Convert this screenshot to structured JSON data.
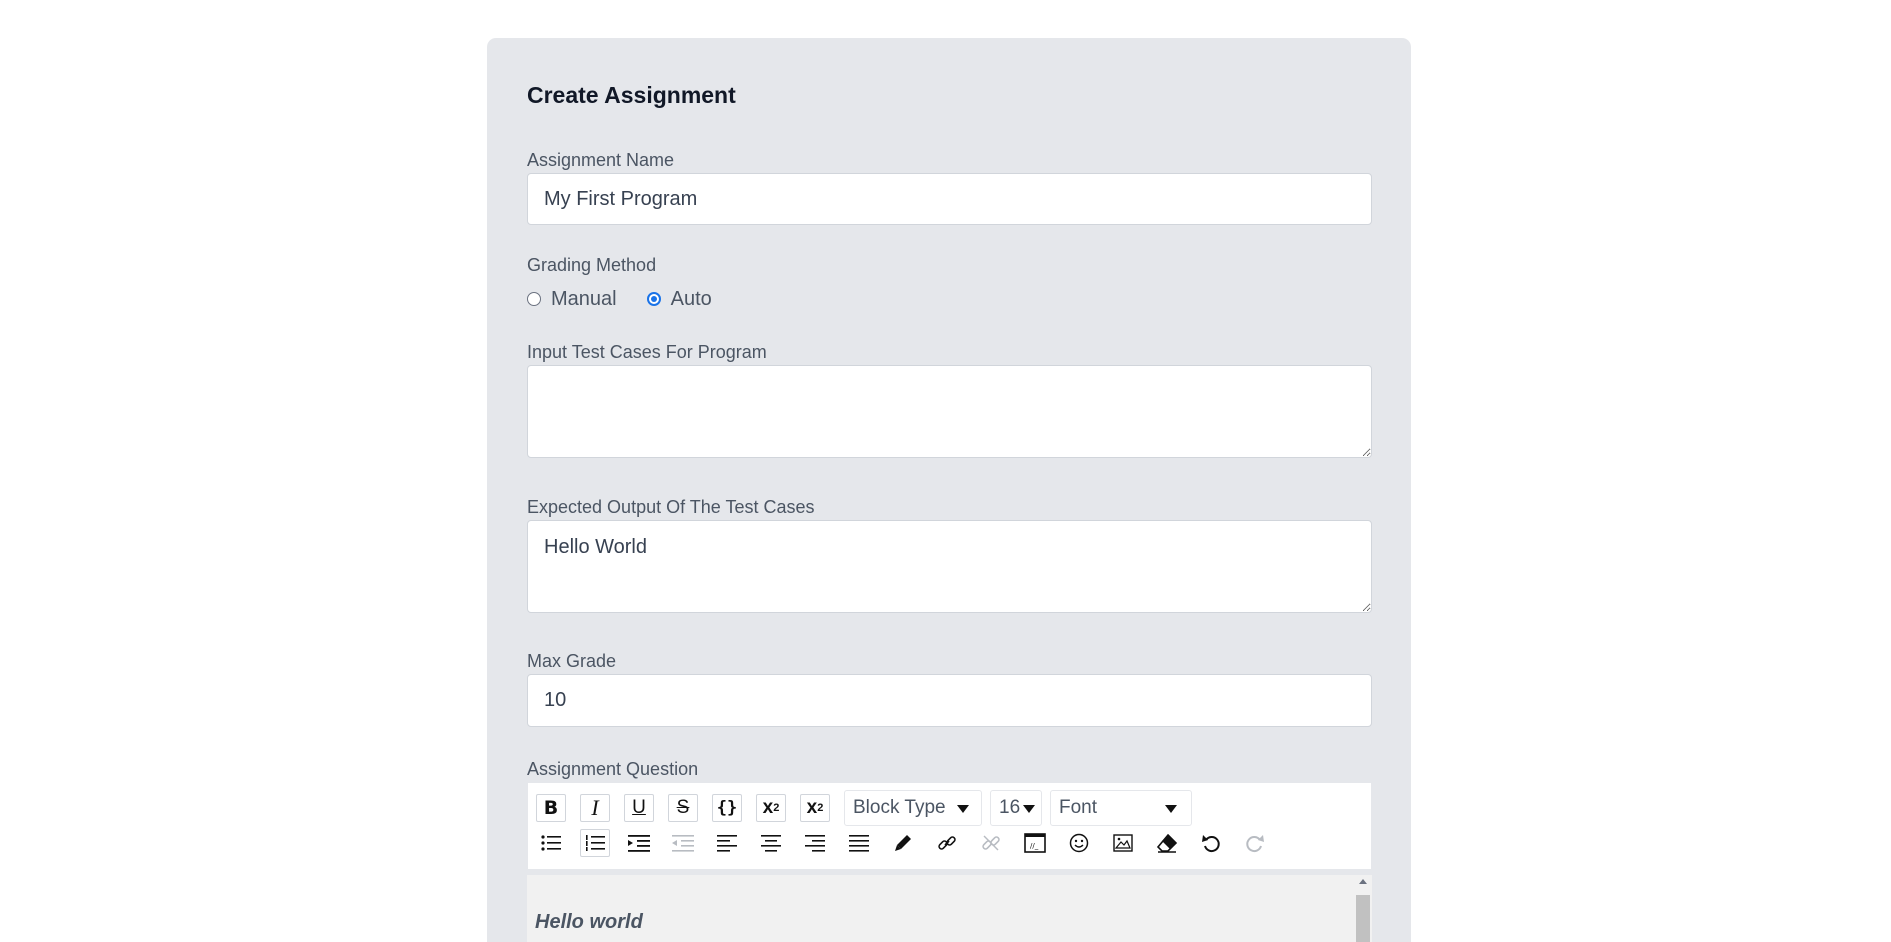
{
  "form": {
    "title": "Create Assignment",
    "assignment_name": {
      "label": "Assignment Name",
      "value": "My First Program"
    },
    "grading_method": {
      "label": "Grading Method",
      "options": [
        {
          "label": "Manual",
          "checked": false
        },
        {
          "label": "Auto",
          "checked": true
        }
      ]
    },
    "input_test_cases": {
      "label": "Input Test Cases For Program",
      "value": ""
    },
    "expected_output": {
      "label": "Expected Output Of The Test Cases",
      "value": "Hello World"
    },
    "max_grade": {
      "label": "Max Grade",
      "value": "10"
    },
    "assignment_question": {
      "label": "Assignment Question"
    }
  },
  "editor": {
    "block_type": "Block Type",
    "font_size": "16",
    "font": "Font",
    "content": "Hello world",
    "toolbar_row1_icons": [
      "bold-icon",
      "italic-icon",
      "underline-icon",
      "strikethrough-icon",
      "code-icon",
      "superscript-icon",
      "subscript-icon"
    ],
    "toolbar_row2_icons": [
      "unordered-list-icon",
      "ordered-list-icon",
      "indent-icon",
      "outdent-icon",
      "align-left-icon",
      "align-center-icon",
      "align-right-icon",
      "align-justify-icon",
      "color-picker-icon",
      "link-icon",
      "unlink-icon",
      "embed-icon",
      "emoji-icon",
      "image-icon",
      "eraser-icon",
      "undo-icon",
      "redo-icon"
    ]
  }
}
